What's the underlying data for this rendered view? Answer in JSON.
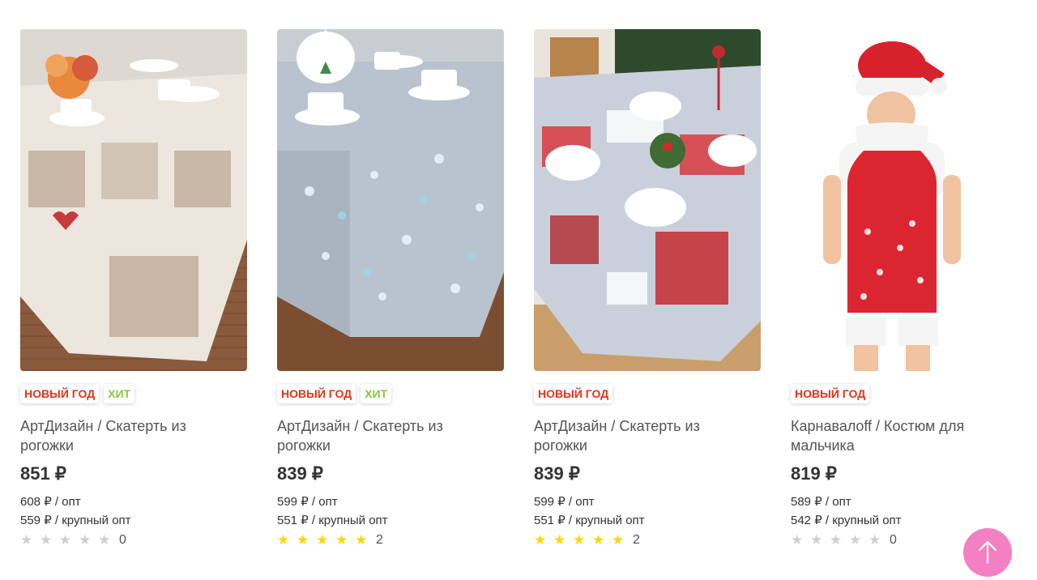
{
  "products": [
    {
      "badges": [
        {
          "text": "НОВЫЙ ГОД",
          "kind": "red"
        },
        {
          "text": "ХИТ",
          "kind": "green"
        }
      ],
      "title_line1": "АртДизайн / Скатерть из",
      "title_line2": "рогожки",
      "price": "851 ₽",
      "opt": "608 ₽ / опт",
      "bulk": "559 ₽ / крупный опт",
      "rating": 0,
      "reviews": "0"
    },
    {
      "badges": [
        {
          "text": "НОВЫЙ ГОД",
          "kind": "red"
        },
        {
          "text": "ХИТ",
          "kind": "green"
        }
      ],
      "title_line1": "АртДизайн / Скатерть из",
      "title_line2": "рогожки",
      "price": "839 ₽",
      "opt": "599 ₽ / опт",
      "bulk": "551 ₽ / крупный опт",
      "rating": 5,
      "reviews": "2"
    },
    {
      "badges": [
        {
          "text": "НОВЫЙ ГОД",
          "kind": "red"
        }
      ],
      "title_line1": "АртДизайн / Скатерть из",
      "title_line2": "рогожки",
      "price": "839 ₽",
      "opt": "599 ₽ / опт",
      "bulk": "551 ₽ / крупный опт",
      "rating": 5,
      "reviews": "2"
    },
    {
      "badges": [
        {
          "text": "НОВЫЙ ГОД",
          "kind": "red"
        }
      ],
      "title_line1": "Карнавалoff / Костюм для",
      "title_line2": "мальчика",
      "price": "819 ₽",
      "opt": "589 ₽ / опт",
      "bulk": "542 ₽ / крупный опт",
      "rating": 0,
      "reviews": "0"
    }
  ],
  "colors": {
    "badge_red": "#e53319",
    "badge_green": "#8cc63f",
    "star_on": "#ffd600",
    "star_off": "#cfcfcf",
    "scroll_top_button": "#f57fc3"
  },
  "icons": {
    "scroll_top": "arrow-up-icon",
    "rating": "star-icon"
  }
}
